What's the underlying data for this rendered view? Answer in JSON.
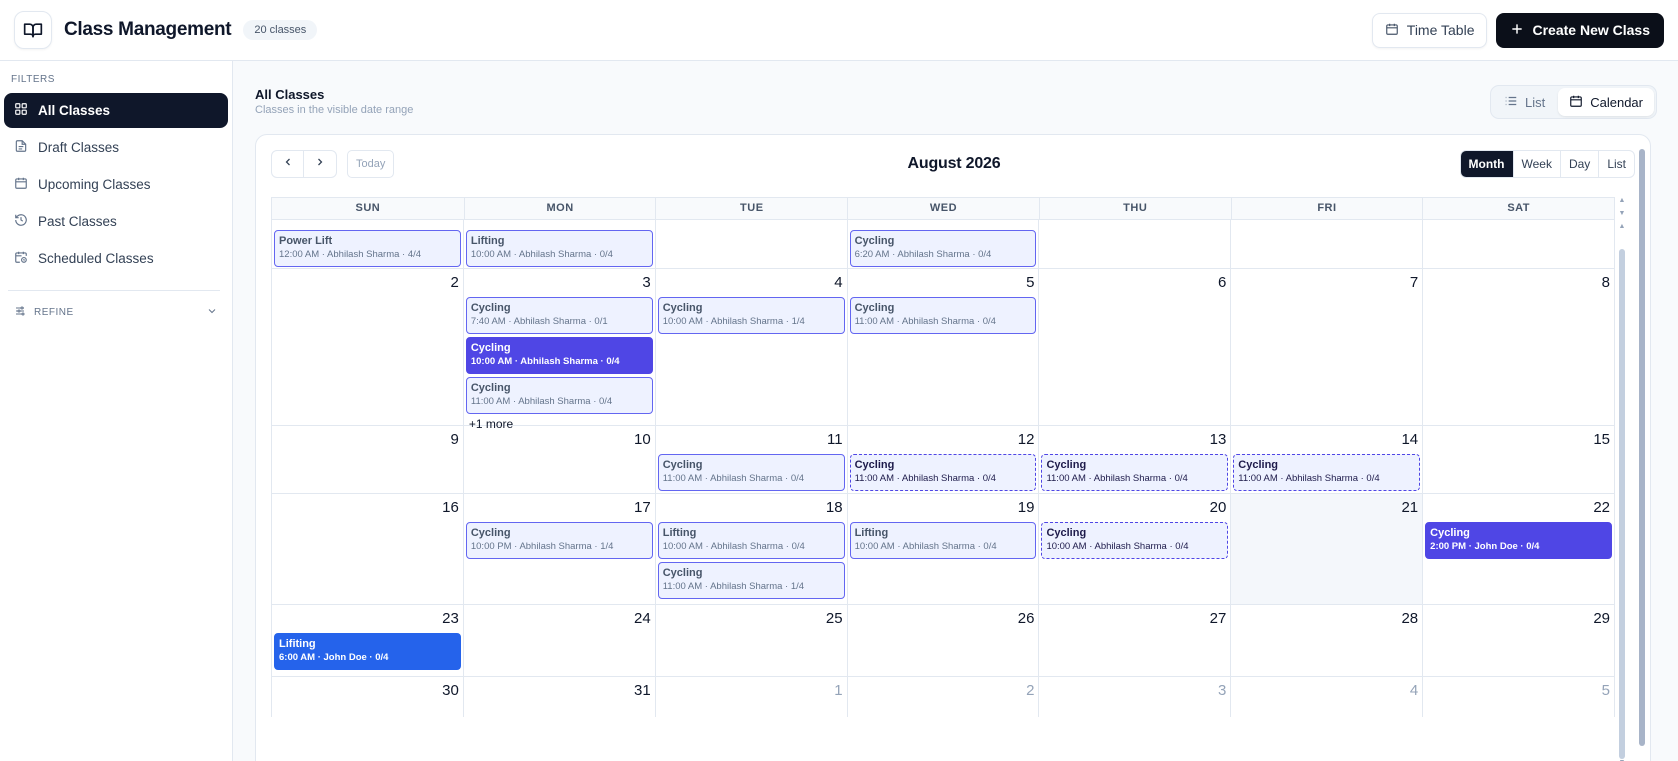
{
  "header": {
    "title": "Class Management",
    "count_badge": "20 classes",
    "timetable_label": "Time Table",
    "create_label": "Create New Class"
  },
  "sidebar": {
    "filters_label": "FILTERS",
    "items": [
      {
        "label": "All Classes",
        "icon": "grid-icon"
      },
      {
        "label": "Draft Classes",
        "icon": "document-icon"
      },
      {
        "label": "Upcoming Classes",
        "icon": "calendar-icon"
      },
      {
        "label": "Past Classes",
        "icon": "history-icon"
      },
      {
        "label": "Scheduled Classes",
        "icon": "calendar-clock-icon"
      }
    ],
    "refine_label": "REFINE"
  },
  "main": {
    "title": "All Classes",
    "subtitle": "Classes in the visible date range",
    "view_list": "List",
    "view_calendar": "Calendar"
  },
  "calendar": {
    "month_title": "August 2026",
    "today_label": "Today",
    "view_buttons": [
      "Month",
      "Week",
      "Day",
      "List"
    ],
    "days_of_week": [
      "SUN",
      "MON",
      "TUE",
      "WED",
      "THU",
      "FRI",
      "SAT"
    ],
    "events": {
      "w0_sun": {
        "title": "Power Lift",
        "sub": "12:00 AM · Abhilash Sharma · 4/4"
      },
      "w0_mon": {
        "title": "Lifting",
        "sub": "10:00 AM · Abhilash Sharma · 0/4"
      },
      "w0_wed": {
        "title": "Cycling",
        "sub": "6:20 AM · Abhilash Sharma · 0/4"
      },
      "w1_mon1": {
        "title": "Cycling",
        "sub": "7:40 AM · Abhilash Sharma · 0/1"
      },
      "w1_mon2": {
        "title": "Cycling",
        "sub": "10:00 AM · Abhilash Sharma · 0/4"
      },
      "w1_mon3": {
        "title": "Cycling",
        "sub": "11:00 AM · Abhilash Sharma · 0/4"
      },
      "w1_more": "+1 more",
      "w1_tue": {
        "title": "Cycling",
        "sub": "10:00 AM · Abhilash Sharma · 1/4"
      },
      "w1_wed": {
        "title": "Cycling",
        "sub": "11:00 AM · Abhilash Sharma · 0/4"
      },
      "w2_tue": {
        "title": "Cycling",
        "sub": "11:00 AM · Abhilash Sharma · 0/4"
      },
      "w2_wed": {
        "title": "Cycling",
        "sub": "11:00 AM · Abhilash Sharma · 0/4"
      },
      "w2_thu": {
        "title": "Cycling",
        "sub": "11:00 AM · Abhilash Sharma · 0/4"
      },
      "w2_fri": {
        "title": "Cycling",
        "sub": "11:00 AM · Abhilash Sharma · 0/4"
      },
      "w3_mon": {
        "title": "Cycling",
        "sub": "10:00 PM · Abhilash Sharma · 1/4"
      },
      "w3_tue1": {
        "title": "Lifting",
        "sub": "10:00 AM · Abhilash Sharma · 0/4"
      },
      "w3_tue2": {
        "title": "Cycling",
        "sub": "11:00 AM · Abhilash Sharma · 1/4"
      },
      "w3_wed": {
        "title": "Lifting",
        "sub": "10:00 AM · Abhilash Sharma · 0/4"
      },
      "w3_thu": {
        "title": "Cycling",
        "sub": "10:00 AM · Abhilash Sharma · 0/4"
      },
      "w3_sat": {
        "title": "Cycling",
        "sub": "2:00 PM · John Doe · 0/4"
      },
      "w4_sun": {
        "title": "Lifiting",
        "sub": "6:00 AM · John Doe · 0/4"
      }
    },
    "weeks": [
      {
        "days": []
      },
      {
        "days": [
          "2",
          "3",
          "4",
          "5",
          "6",
          "7",
          "8"
        ]
      },
      {
        "days": [
          "9",
          "10",
          "11",
          "12",
          "13",
          "14",
          "15"
        ]
      },
      {
        "days": [
          "16",
          "17",
          "18",
          "19",
          "20",
          "21",
          "22"
        ]
      },
      {
        "days": [
          "23",
          "24",
          "25",
          "26",
          "27",
          "28",
          "29"
        ]
      },
      {
        "days": [
          "30",
          "31",
          "1",
          "2",
          "3",
          "4",
          "5"
        ]
      }
    ]
  }
}
